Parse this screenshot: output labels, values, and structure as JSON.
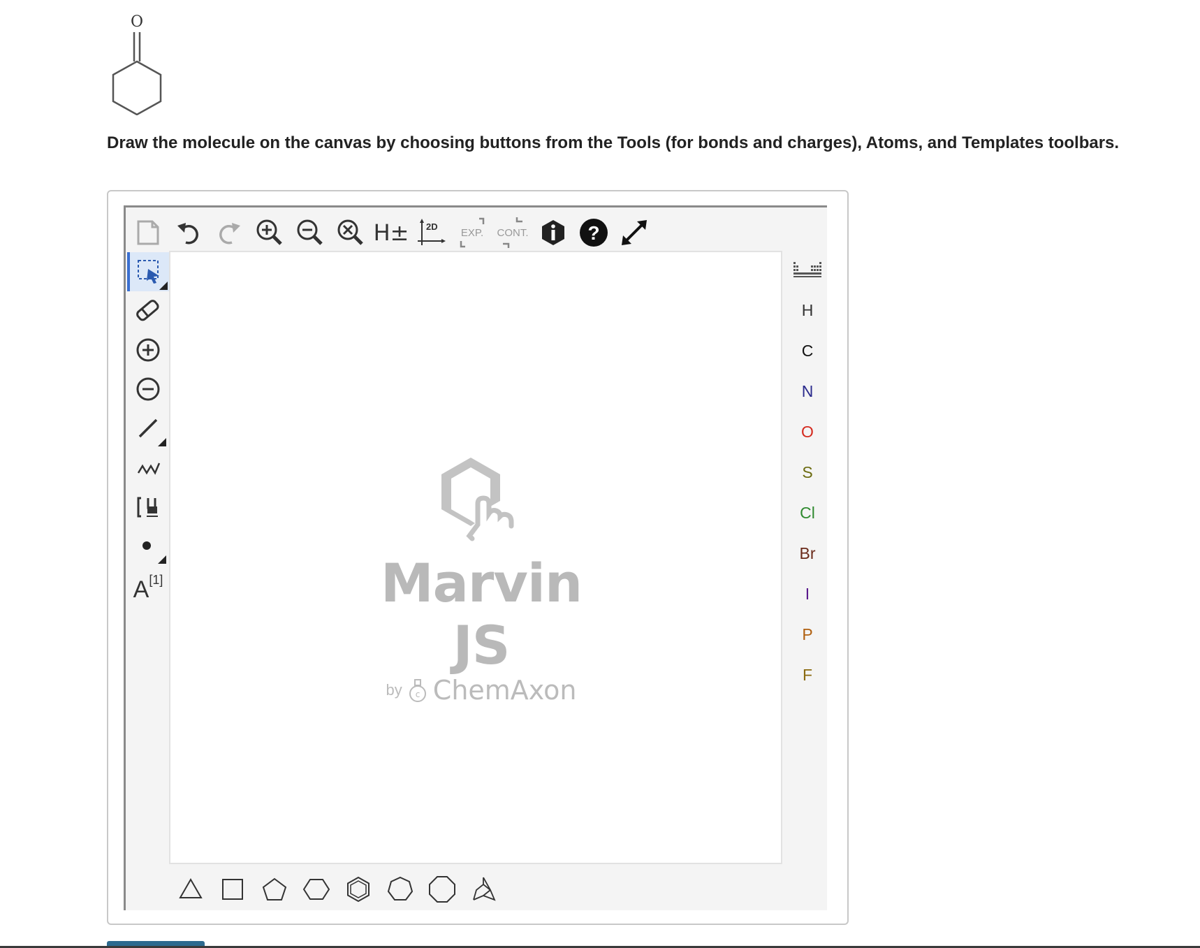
{
  "molecule": {
    "atom_label": "O",
    "name_icon": "cyclohexanone-structure"
  },
  "prompt": {
    "text": "Draw the molecule on the canvas by choosing buttons from the Tools (for bonds and charges), Atoms, and Templates toolbars."
  },
  "top_toolbar": {
    "hydrogens_label": "H±",
    "clean2d_label": "2D",
    "expand_label": "EXP.",
    "contract_label": "CONT."
  },
  "left_toolbar": {
    "active_tool": "selection-tool",
    "atom_map_label": "A",
    "atom_map_index": "[1]"
  },
  "watermark": {
    "title": "Marvin JS",
    "by": "by",
    "brand": "ChemAxon"
  },
  "atoms": [
    {
      "symbol": "H",
      "color": "#333333"
    },
    {
      "symbol": "C",
      "color": "#111111"
    },
    {
      "symbol": "N",
      "color": "#2a2a8c"
    },
    {
      "symbol": "O",
      "color": "#d42a1e"
    },
    {
      "symbol": "S",
      "color": "#6b6b10"
    },
    {
      "symbol": "Cl",
      "color": "#2f8a2f"
    },
    {
      "symbol": "Br",
      "color": "#6a2a1a"
    },
    {
      "symbol": "I",
      "color": "#5a1a8c"
    },
    {
      "symbol": "P",
      "color": "#b06010"
    },
    {
      "symbol": "F",
      "color": "#8a6a10"
    }
  ],
  "colors": {
    "accent": "#3a6fd0",
    "submit": "#2d6a8f"
  }
}
